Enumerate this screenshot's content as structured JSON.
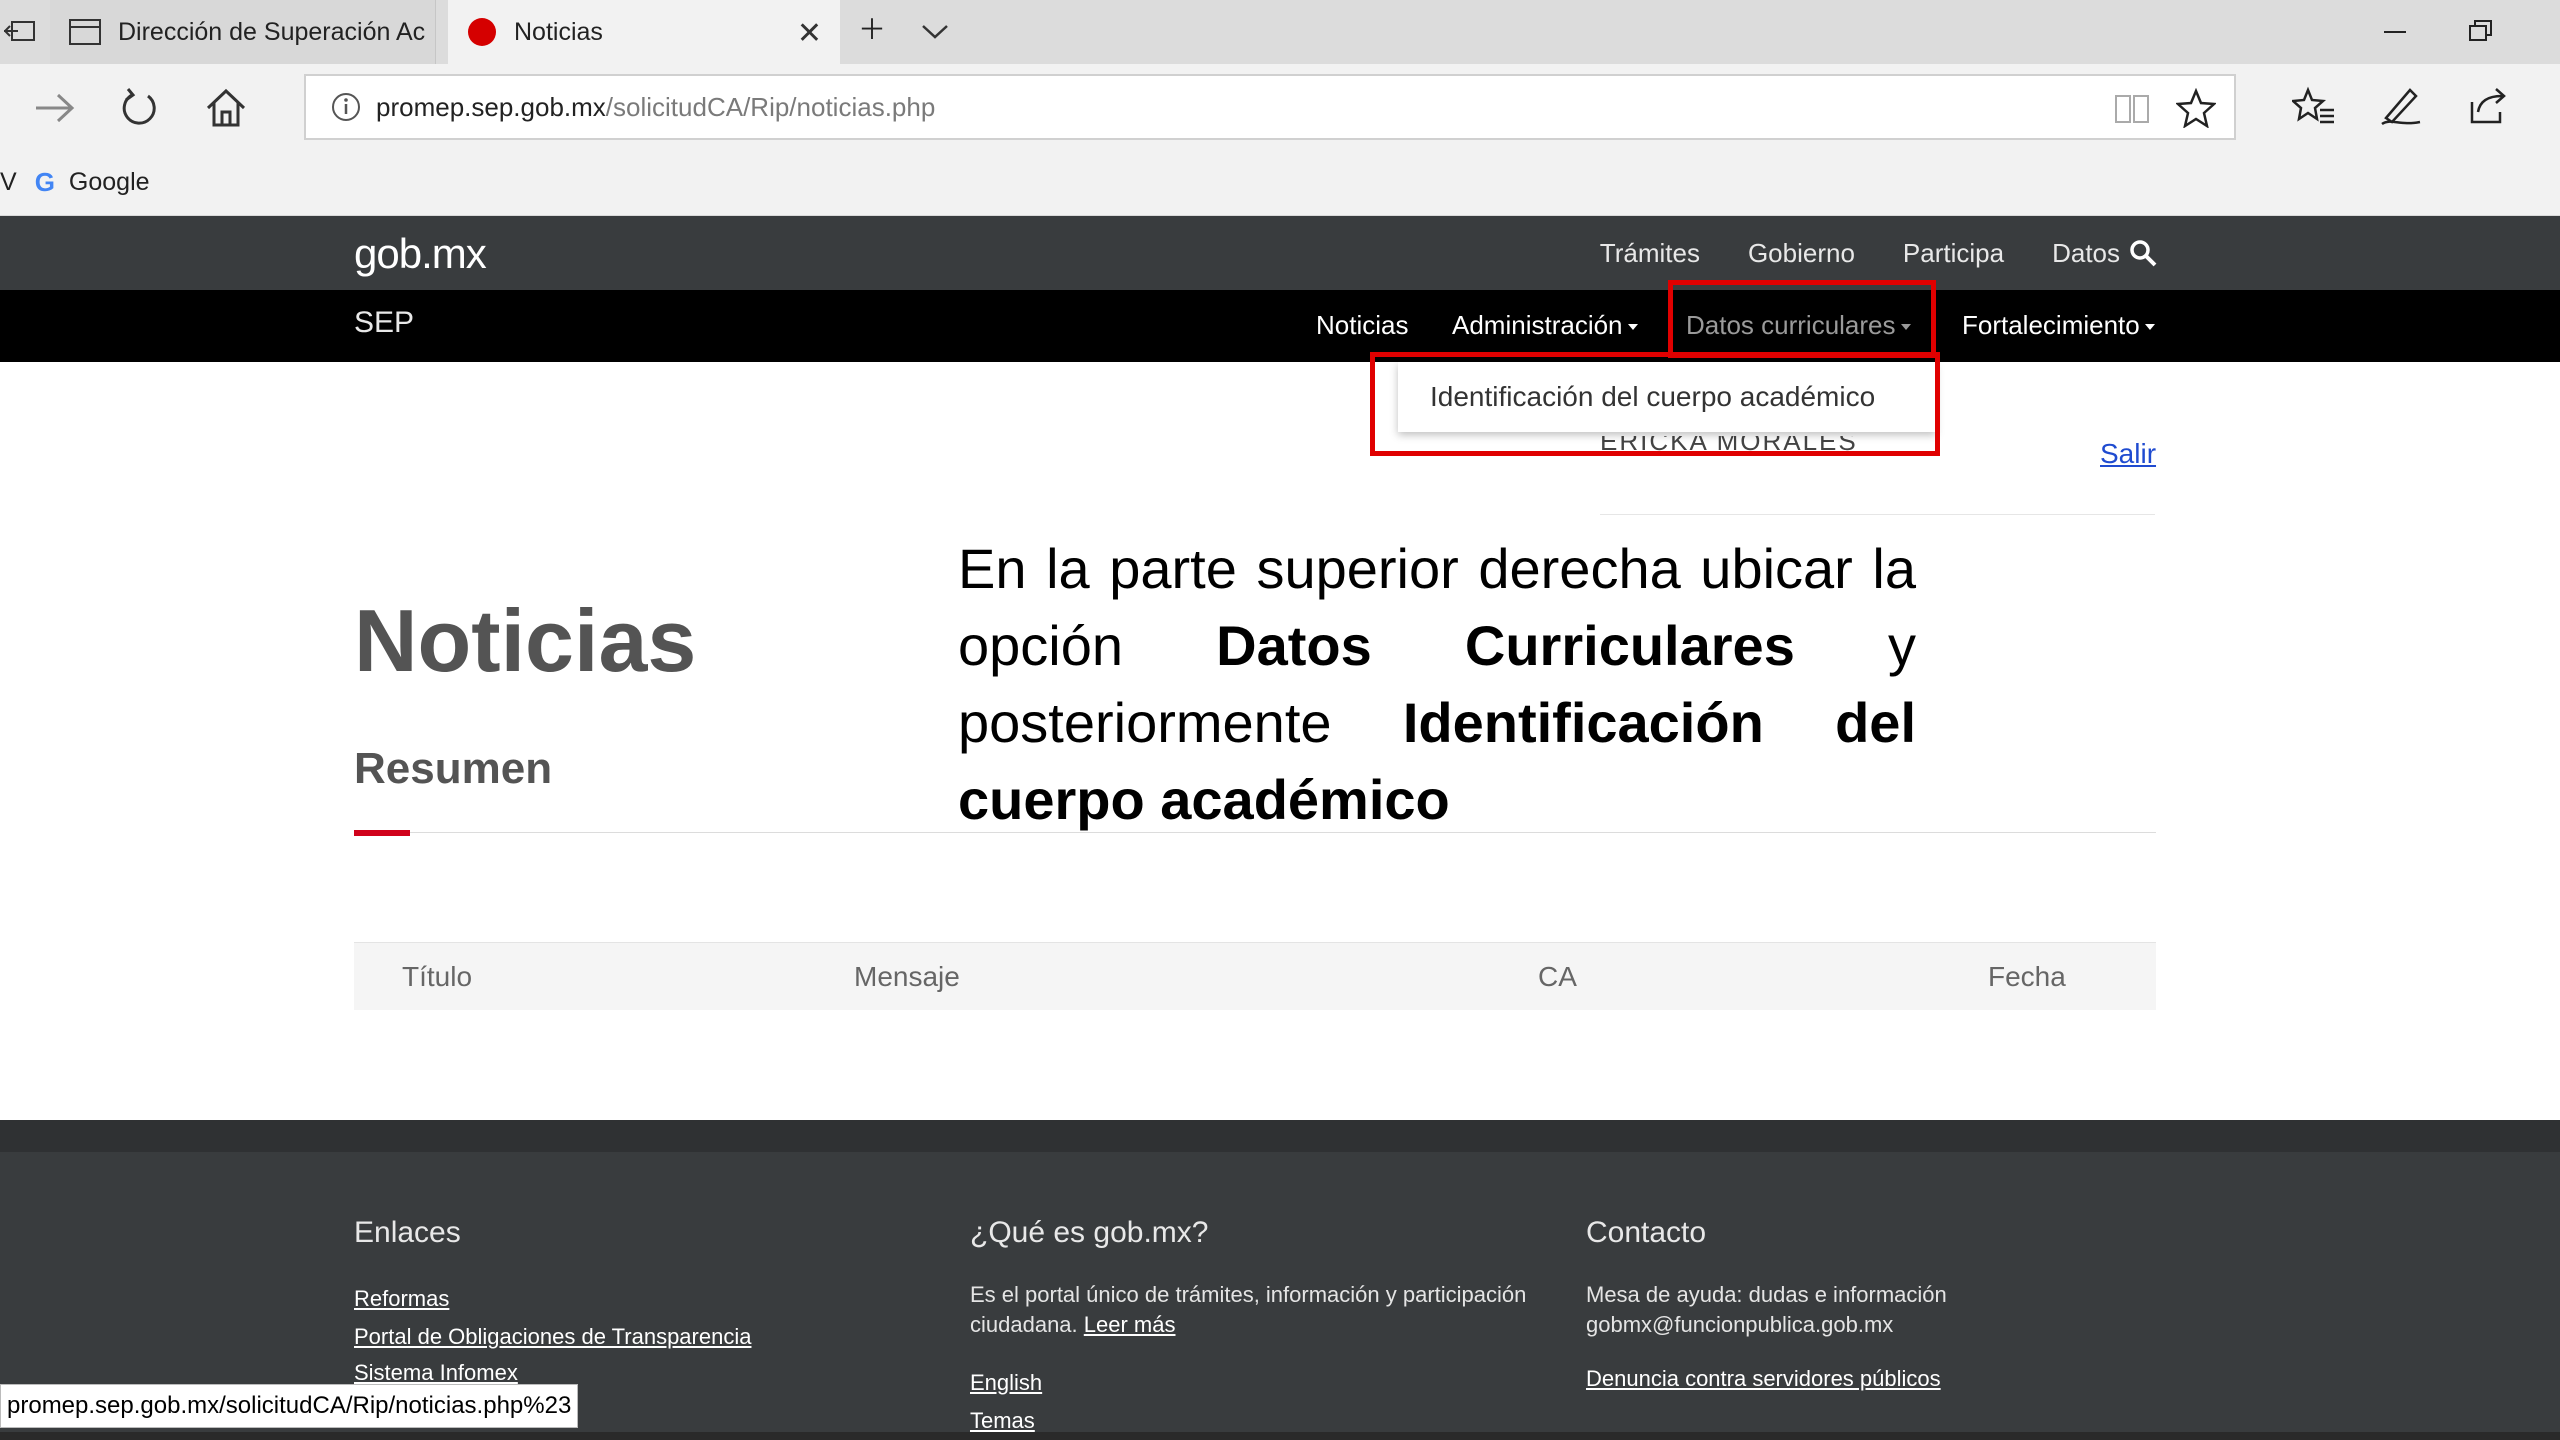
{
  "browser": {
    "tabs": [
      {
        "label": "Dirección de Superación Ac",
        "active": false
      },
      {
        "label": "Noticias",
        "active": true
      }
    ],
    "url": {
      "host": "promep.sep.gob.mx",
      "path": "/solicitudCA/Rip/noticias.php"
    },
    "favorites": [
      {
        "label": "V"
      },
      {
        "label": "Google"
      }
    ],
    "status_url": "promep.sep.gob.mx/solicitudCA/Rip/noticias.php%23"
  },
  "header": {
    "logo": "gob.mx",
    "top_nav": [
      "Trámites",
      "Gobierno",
      "Participa",
      "Datos"
    ],
    "section_title": "SEP",
    "sep_nav": {
      "noticias": "Noticias",
      "administracion": "Administración",
      "datos_curriculares": "Datos curriculares",
      "fortalecimiento": "Fortalecimiento"
    },
    "dropdown_item": "Identificación del cuerpo académico",
    "user_peek": "ERICKA MORALES",
    "salir": "Salir"
  },
  "main": {
    "title": "Noticias",
    "subtitle": "Resumen",
    "table_headers": [
      "Título",
      "Mensaje",
      "CA",
      "Fecha"
    ]
  },
  "instruction": {
    "part1": "En la parte superior derecha ubicar la opción ",
    "bold1": "Datos Curriculares",
    "part2": " y posteriormente ",
    "bold2": "Identificación del cuerpo académico"
  },
  "footer": {
    "enlaces": {
      "title": "Enlaces",
      "links": [
        "Reformas",
        "Portal de Obligaciones de Transparencia",
        "Sistema Infomex"
      ]
    },
    "que_es": {
      "title": "¿Qué es gob.mx?",
      "text": "Es el portal único de trámites, información y participación ciudadana.",
      "leer_mas": "Leer más",
      "links": [
        "English",
        "Temas"
      ]
    },
    "contacto": {
      "title": "Contacto",
      "line1": "Mesa de ayuda: dudas e información",
      "email": "gobmx@funcionpublica.gob.mx",
      "denuncia": "Denuncia contra servidores públicos"
    }
  },
  "colors": {
    "highlight": "#e00000",
    "accent_red": "#d0021b",
    "gob_dark": "#393c3e",
    "link_blue": "#1f4bd0"
  }
}
